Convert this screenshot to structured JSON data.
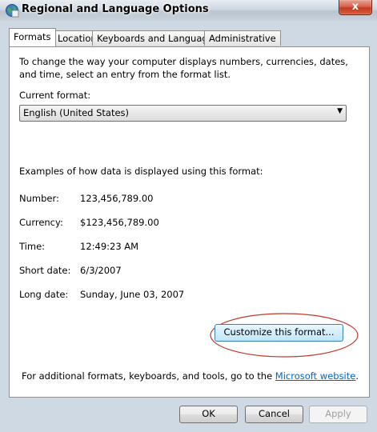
{
  "window": {
    "title": "Regional and Language Options",
    "close_glyph": "x",
    "icon": "globe-icon"
  },
  "tabs": [
    {
      "label": "Formats",
      "active": true
    },
    {
      "label": "Location",
      "active": false
    },
    {
      "label": "Keyboards and Languages",
      "active": false
    },
    {
      "label": "Administrative",
      "active": false
    }
  ],
  "formats": {
    "intro": "To change the way your computer displays numbers, currencies, dates, and time, select an entry from the format list.",
    "current_format_label": "Current format:",
    "current_format_value": "English (United States)",
    "examples_heading": "Examples of how data is displayed using this format:",
    "examples": [
      {
        "label": "Number:",
        "value": "123,456,789.00"
      },
      {
        "label": "Currency:",
        "value": "$123,456,789.00"
      },
      {
        "label": "Time:",
        "value": "12:49:23 AM"
      },
      {
        "label": "Short date:",
        "value": "6/3/2007"
      },
      {
        "label": "Long date:",
        "value": "Sunday, June 03, 2007"
      }
    ],
    "customize_button": "Customize this format...",
    "footer_prefix": "For additional formats, keyboards, and tools, go to the ",
    "footer_link": "Microsoft website",
    "footer_suffix": "."
  },
  "buttons": {
    "ok": "OK",
    "cancel": "Cancel",
    "apply": "Apply"
  },
  "colors": {
    "annotation_ellipse": "#c0392b",
    "link": "#0066cc"
  }
}
